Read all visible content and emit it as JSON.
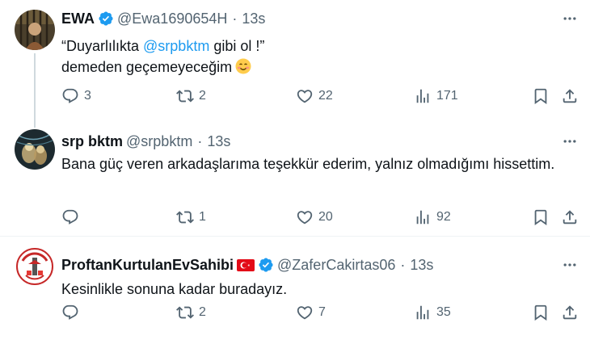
{
  "tweets": [
    {
      "name": "EWA",
      "verified": true,
      "handle": "@Ewa1690654H",
      "time": "13s",
      "text_line1_before": "“Duyarlılıkta ",
      "mention": "@srpbktm",
      "text_line1_after": " gibi ol !”",
      "text_line2": "demeden geçemeyeceğim",
      "emoji": "smiling-face-emoji",
      "replies": "3",
      "retweets": "2",
      "likes": "22",
      "views": "171"
    },
    {
      "name": "srp bktm",
      "handle": "@srpbktm",
      "time": "13s",
      "text": "Bana güç veren arkadaşlarıma teşekkür ederim, yalnız olmadığımı hissettim.",
      "replies": "",
      "retweets": "1",
      "likes": "20",
      "views": "92"
    },
    {
      "name": "ProftanKurtulanEvSahibi",
      "flag": "turkey-flag",
      "verified": true,
      "handle": "@ZaferCakirtas06",
      "time": "13s",
      "text": "Kesinlikle sonuna kadar buradayız.",
      "replies": "",
      "retweets": "2",
      "likes": "7",
      "views": "35"
    }
  ],
  "separator": "·",
  "colors": {
    "text": "#0f1419",
    "muted": "#536471",
    "accent": "#1d9bf0",
    "divider": "#eff3f4"
  }
}
